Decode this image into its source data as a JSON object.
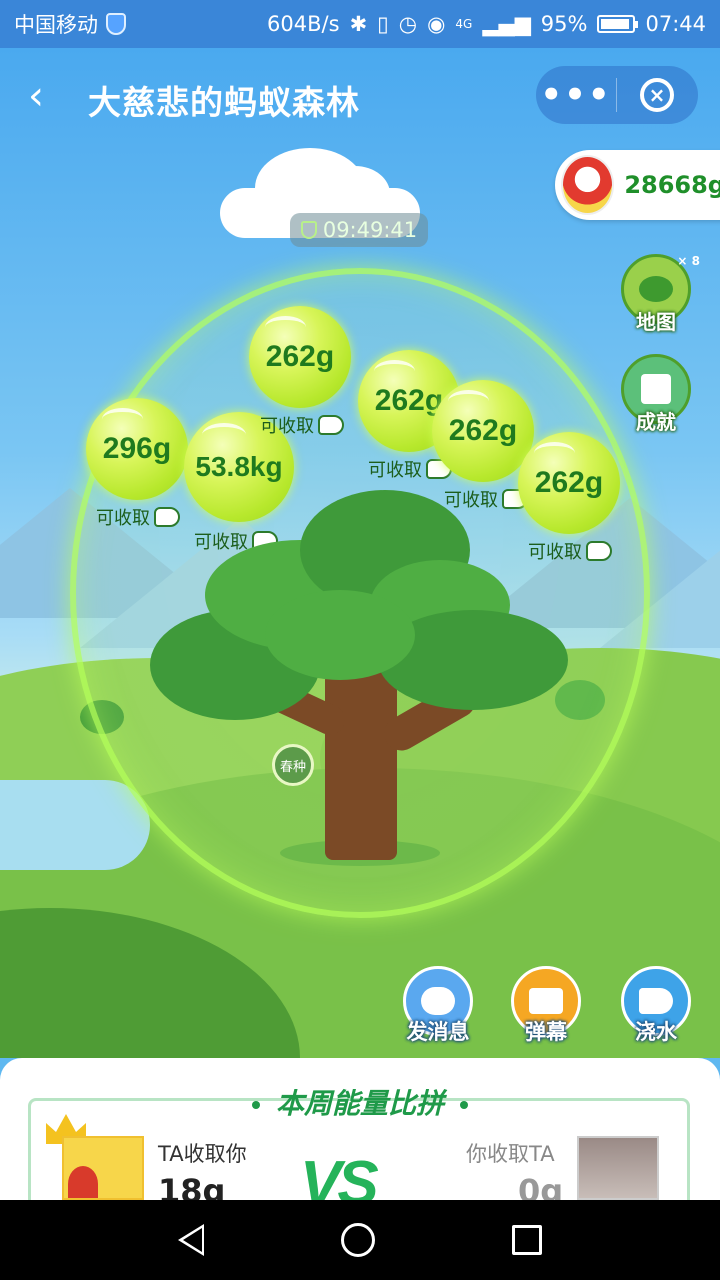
{
  "status_bar": {
    "carrier": "中国移动",
    "speed": "604B/s",
    "network": "4G",
    "battery": "95%",
    "time": "07:44"
  },
  "header": {
    "back_icon": "‹",
    "title": "大慈悲的蚂蚁森林",
    "more_label": "•••",
    "close_label": "×"
  },
  "user_energy": "28668g",
  "timer": "09:49:41",
  "side_buttons": {
    "map": {
      "label": "地图",
      "count": "× 8"
    },
    "achievement": {
      "label": "成就"
    }
  },
  "bubbles": [
    {
      "value": "296g",
      "action": "可收取"
    },
    {
      "value": "53.8kg",
      "action": "可收取"
    },
    {
      "value": "262g",
      "action": "可收取"
    },
    {
      "value": "262g",
      "action": "可收取"
    },
    {
      "value": "262g",
      "action": "可收取"
    },
    {
      "value": "262g",
      "action": "可收取"
    }
  ],
  "tree_tag": "春种",
  "actions": {
    "message": "发消息",
    "danmu": "弹幕",
    "water": "浇水"
  },
  "weekly": {
    "title": "本周能量比拼",
    "left_label": "TA收取你",
    "left_value": "18g",
    "vs": "VS",
    "right_label": "你收取TA",
    "right_value": "0g"
  },
  "colors": {
    "accent_green": "#1f9a49",
    "status_blue": "#3a86d8",
    "bubble_green": "#b7e82c"
  }
}
